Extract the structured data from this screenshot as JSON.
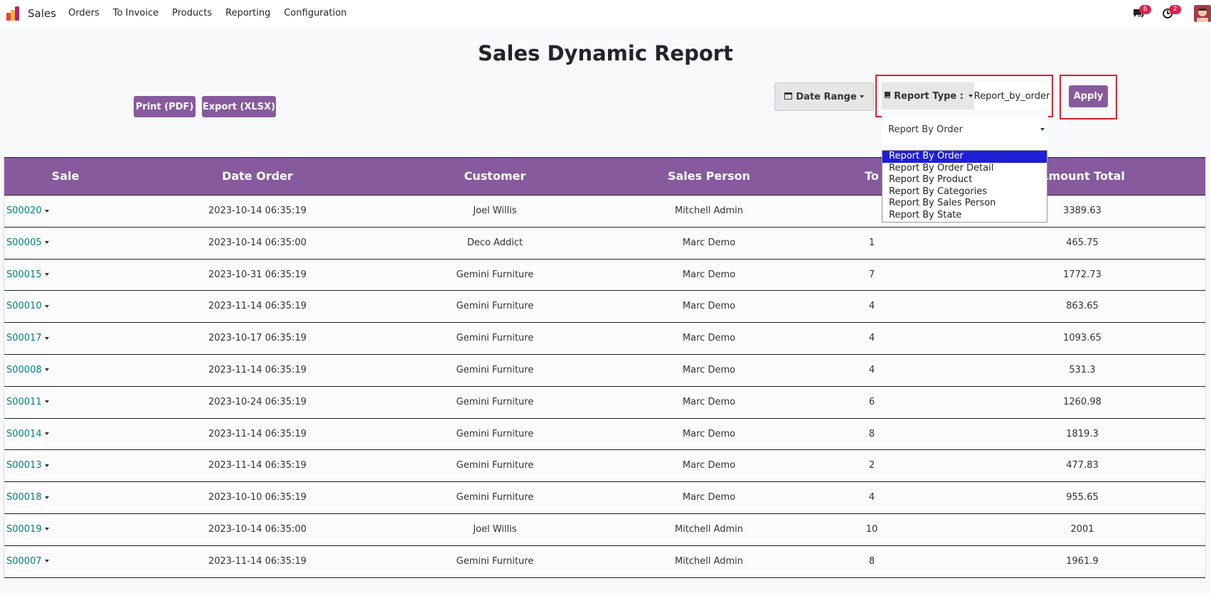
{
  "app": {
    "name": "Sales"
  },
  "menu": [
    "Orders",
    "To Invoice",
    "Products",
    "Reporting",
    "Configuration"
  ],
  "systray": {
    "messages_count": "6",
    "activities_count": "2"
  },
  "page": {
    "title": "Sales Dynamic Report"
  },
  "toolbar": {
    "print_label": "Print (PDF)",
    "export_label": "Export (XLSX)",
    "date_range_label": "Date Range",
    "report_type_label": "Report Type :",
    "report_type_value": "Report_by_order",
    "apply_label": "Apply"
  },
  "report_select": {
    "selected": "Report By Order",
    "options": [
      "Report By Order",
      "Report By Order Detail",
      "Report By Product",
      "Report By Categories",
      "Report By Sales Person",
      "Report By State"
    ],
    "highlighted_index": 0
  },
  "table": {
    "headers": {
      "sale": "Sale",
      "date_order": "Date Order",
      "customer": "Customer",
      "sales_person": "Sales Person",
      "total_partial": "To",
      "amount_total": "Amount Total"
    },
    "rows": [
      {
        "sale": "S00020",
        "date": "2023-10-14 06:35:19",
        "customer": "Joel Willis",
        "person": "Mitchell Admin",
        "qty": "",
        "amount": "3389.63"
      },
      {
        "sale": "S00005",
        "date": "2023-10-14 06:35:00",
        "customer": "Deco Addict",
        "person": "Marc Demo",
        "qty": "1",
        "amount": "465.75"
      },
      {
        "sale": "S00015",
        "date": "2023-10-31 06:35:19",
        "customer": "Gemini Furniture",
        "person": "Marc Demo",
        "qty": "7",
        "amount": "1772.73"
      },
      {
        "sale": "S00010",
        "date": "2023-11-14 06:35:19",
        "customer": "Gemini Furniture",
        "person": "Marc Demo",
        "qty": "4",
        "amount": "863.65"
      },
      {
        "sale": "S00017",
        "date": "2023-10-17 06:35:19",
        "customer": "Gemini Furniture",
        "person": "Marc Demo",
        "qty": "4",
        "amount": "1093.65"
      },
      {
        "sale": "S00008",
        "date": "2023-11-14 06:35:19",
        "customer": "Gemini Furniture",
        "person": "Marc Demo",
        "qty": "4",
        "amount": "531.3"
      },
      {
        "sale": "S00011",
        "date": "2023-10-24 06:35:19",
        "customer": "Gemini Furniture",
        "person": "Marc Demo",
        "qty": "6",
        "amount": "1260.98"
      },
      {
        "sale": "S00014",
        "date": "2023-11-14 06:35:19",
        "customer": "Gemini Furniture",
        "person": "Marc Demo",
        "qty": "8",
        "amount": "1819.3"
      },
      {
        "sale": "S00013",
        "date": "2023-11-14 06:35:19",
        "customer": "Gemini Furniture",
        "person": "Marc Demo",
        "qty": "2",
        "amount": "477.83"
      },
      {
        "sale": "S00018",
        "date": "2023-10-10 06:35:19",
        "customer": "Gemini Furniture",
        "person": "Marc Demo",
        "qty": "4",
        "amount": "955.65"
      },
      {
        "sale": "S00019",
        "date": "2023-10-14 06:35:00",
        "customer": "Joel Willis",
        "person": "Mitchell Admin",
        "qty": "10",
        "amount": "2001"
      },
      {
        "sale": "S00007",
        "date": "2023-11-14 06:35:19",
        "customer": "Gemini Furniture",
        "person": "Mitchell Admin",
        "qty": "8",
        "amount": "1961.9"
      }
    ]
  },
  "colors": {
    "primary": "#875a9e",
    "link": "#017e84",
    "highlight_box": "#e0202a",
    "selected_option": "#1e1ed6"
  }
}
